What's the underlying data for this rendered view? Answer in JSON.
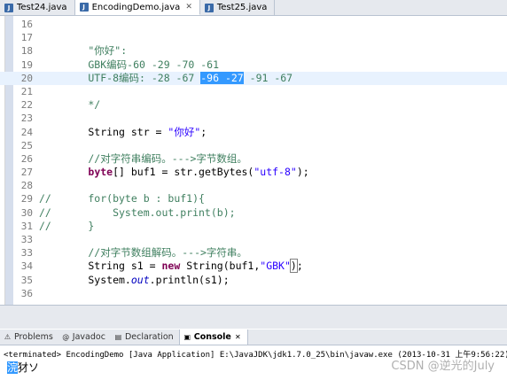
{
  "editor_tabs": [
    {
      "label": "Test24.java",
      "active": false
    },
    {
      "label": "EncodingDemo.java",
      "active": true,
      "close": "✕"
    },
    {
      "label": "Test25.java",
      "active": false
    }
  ],
  "code_lines": [
    {
      "num": "16",
      "parts": []
    },
    {
      "num": "17",
      "parts": []
    },
    {
      "num": "18",
      "parts": [
        {
          "t": "        \"你好\":",
          "c": "cmt"
        }
      ]
    },
    {
      "num": "19",
      "parts": [
        {
          "t": "        GBK编码-60 -29 -70 -61",
          "c": "cmt"
        }
      ]
    },
    {
      "num": "20",
      "current": true,
      "parts": [
        {
          "t": "        UTF-8编码: -28 -67 ",
          "c": "cmt"
        },
        {
          "t": "-96 -27",
          "c": "sel"
        },
        {
          "t": " -91 -67",
          "c": "cmt"
        }
      ]
    },
    {
      "num": "21",
      "parts": []
    },
    {
      "num": "22",
      "parts": [
        {
          "t": "        */",
          "c": "cmt"
        }
      ]
    },
    {
      "num": "23",
      "parts": []
    },
    {
      "num": "24",
      "parts": [
        {
          "t": "        String str = ",
          "c": ""
        },
        {
          "t": "\"你好\"",
          "c": "str"
        },
        {
          "t": ";",
          "c": ""
        }
      ]
    },
    {
      "num": "25",
      "parts": []
    },
    {
      "num": "26",
      "parts": [
        {
          "t": "        //对字符串编码。--->字节数组。",
          "c": "cmt"
        }
      ]
    },
    {
      "num": "27",
      "parts": [
        {
          "t": "        ",
          "c": ""
        },
        {
          "t": "byte",
          "c": "kw"
        },
        {
          "t": "[] buf1 = str.getBytes(",
          "c": ""
        },
        {
          "t": "\"utf-8\"",
          "c": "str"
        },
        {
          "t": ");",
          "c": ""
        }
      ]
    },
    {
      "num": "28",
      "parts": []
    },
    {
      "num": "29",
      "parts": [
        {
          "t": "//      for(byte b : buf1){",
          "c": "cmt"
        }
      ]
    },
    {
      "num": "30",
      "parts": [
        {
          "t": "//          System.out.print(b);",
          "c": "cmt"
        }
      ]
    },
    {
      "num": "31",
      "parts": [
        {
          "t": "//      }",
          "c": "cmt"
        }
      ]
    },
    {
      "num": "33",
      "parts": []
    },
    {
      "num": "33",
      "parts": [
        {
          "t": "        //对字节数组解码。--->字符串。",
          "c": "cmt"
        }
      ]
    },
    {
      "num": "34",
      "parts": [
        {
          "t": "        String s1 = ",
          "c": ""
        },
        {
          "t": "new",
          "c": "kw"
        },
        {
          "t": " String(buf1,",
          "c": ""
        },
        {
          "t": "\"GBK\"",
          "c": "str"
        },
        {
          "t": ")",
          "c": "boxed"
        },
        {
          "t": ";",
          "c": ""
        }
      ]
    },
    {
      "num": "35",
      "parts": [
        {
          "t": "        System.",
          "c": ""
        },
        {
          "t": "out",
          "c": "fld"
        },
        {
          "t": ".println(s1);",
          "c": ""
        }
      ]
    },
    {
      "num": "36",
      "parts": []
    }
  ],
  "view_tabs": [
    {
      "label": "Problems",
      "icon": "problems-icon",
      "glyph": "⚠",
      "active": false
    },
    {
      "label": "Javadoc",
      "icon": "javadoc-icon",
      "glyph": "@",
      "active": false
    },
    {
      "label": "Declaration",
      "icon": "declaration-icon",
      "glyph": "▤",
      "active": false
    },
    {
      "label": "Console",
      "icon": "console-icon",
      "glyph": "▣",
      "active": true,
      "close": "✕"
    }
  ],
  "console": {
    "status": "<terminated> EncodingDemo [Java Application] E:\\JavaJDK\\jdk1.7.0_25\\bin\\javaw.exe (2013-10-31 上午9:56:22)",
    "output_first": "浣",
    "output_rest": "犲ソ"
  },
  "watermark": "CSDN @逆光的July",
  "colors": {
    "comment": "#3f7f5f",
    "keyword": "#7f0055",
    "string": "#2a00ff",
    "selection": "#3399ff",
    "gutter": "#d6deec"
  }
}
